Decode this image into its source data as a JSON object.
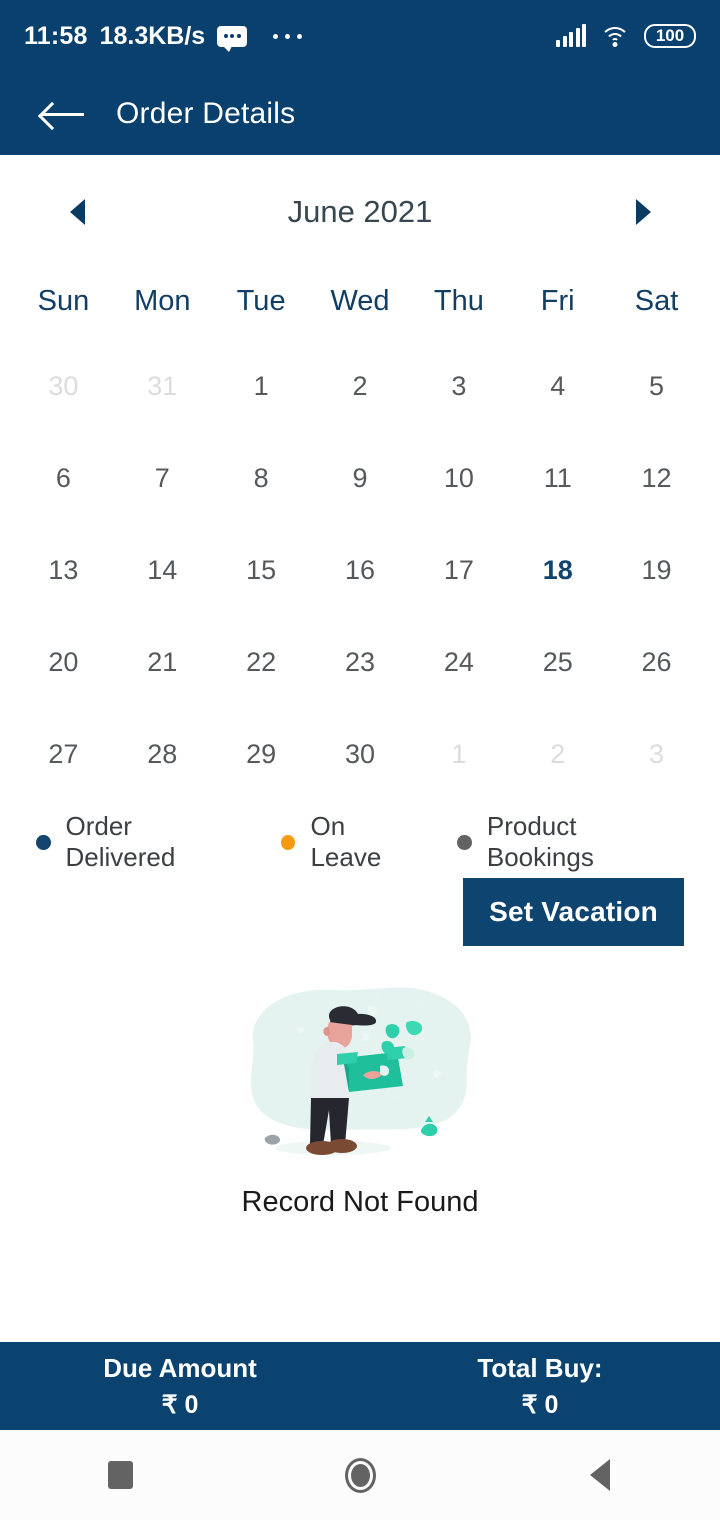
{
  "status_bar": {
    "time": "11:58",
    "network_speed": "18.3KB/s",
    "battery_level": "100",
    "icons": [
      "message-bubble-icon",
      "overflow-dots-icon",
      "signal-icon",
      "wifi-icon",
      "battery-icon"
    ]
  },
  "app_bar": {
    "title": "Order Details",
    "back_icon": "back-arrow-icon"
  },
  "calendar": {
    "month_label": "June 2021",
    "prev_icon": "chevron-left-icon",
    "next_icon": "chevron-right-icon",
    "weekdays": [
      "Sun",
      "Mon",
      "Tue",
      "Wed",
      "Thu",
      "Fri",
      "Sat"
    ],
    "selected_day": "18",
    "days": [
      {
        "label": "30",
        "state": "muted"
      },
      {
        "label": "31",
        "state": "muted"
      },
      {
        "label": "1",
        "state": "normal"
      },
      {
        "label": "2",
        "state": "normal"
      },
      {
        "label": "3",
        "state": "normal"
      },
      {
        "label": "4",
        "state": "normal"
      },
      {
        "label": "5",
        "state": "normal"
      },
      {
        "label": "6",
        "state": "normal"
      },
      {
        "label": "7",
        "state": "normal"
      },
      {
        "label": "8",
        "state": "normal"
      },
      {
        "label": "9",
        "state": "normal"
      },
      {
        "label": "10",
        "state": "normal"
      },
      {
        "label": "11",
        "state": "normal"
      },
      {
        "label": "12",
        "state": "normal"
      },
      {
        "label": "13",
        "state": "normal"
      },
      {
        "label": "14",
        "state": "normal"
      },
      {
        "label": "15",
        "state": "normal"
      },
      {
        "label": "16",
        "state": "normal"
      },
      {
        "label": "17",
        "state": "normal"
      },
      {
        "label": "18",
        "state": "selected"
      },
      {
        "label": "19",
        "state": "normal"
      },
      {
        "label": "20",
        "state": "normal"
      },
      {
        "label": "21",
        "state": "normal"
      },
      {
        "label": "22",
        "state": "normal"
      },
      {
        "label": "23",
        "state": "normal"
      },
      {
        "label": "24",
        "state": "normal"
      },
      {
        "label": "25",
        "state": "normal"
      },
      {
        "label": "26",
        "state": "normal"
      },
      {
        "label": "27",
        "state": "normal"
      },
      {
        "label": "28",
        "state": "normal"
      },
      {
        "label": "29",
        "state": "normal"
      },
      {
        "label": "30",
        "state": "normal"
      },
      {
        "label": "1",
        "state": "muted"
      },
      {
        "label": "2",
        "state": "muted"
      },
      {
        "label": "3",
        "state": "muted"
      }
    ]
  },
  "legend": [
    {
      "label": "Order Delivered",
      "color": "#14456F"
    },
    {
      "label": "On Leave",
      "color": "#F59A11"
    },
    {
      "label": "Product Bookings",
      "color": "#636363"
    }
  ],
  "vacation_button": {
    "label": "Set Vacation"
  },
  "empty_state": {
    "message": "Record Not Found",
    "illustration": "person-with-box-illustration"
  },
  "summary_bar": {
    "due": {
      "title": "Due Amount",
      "value": "₹ 0"
    },
    "total": {
      "title": "Total Buy:",
      "value": "₹ 0"
    }
  },
  "nav_bar": {
    "recents_icon": "square-recents-icon",
    "home_icon": "circle-home-icon",
    "back_icon": "triangle-back-icon"
  },
  "colors": {
    "primary_blue": "#09406D",
    "card_bg": "#FFFFFF",
    "accent_orange": "#F59A11",
    "muted_gray": "#DCDCDC"
  }
}
